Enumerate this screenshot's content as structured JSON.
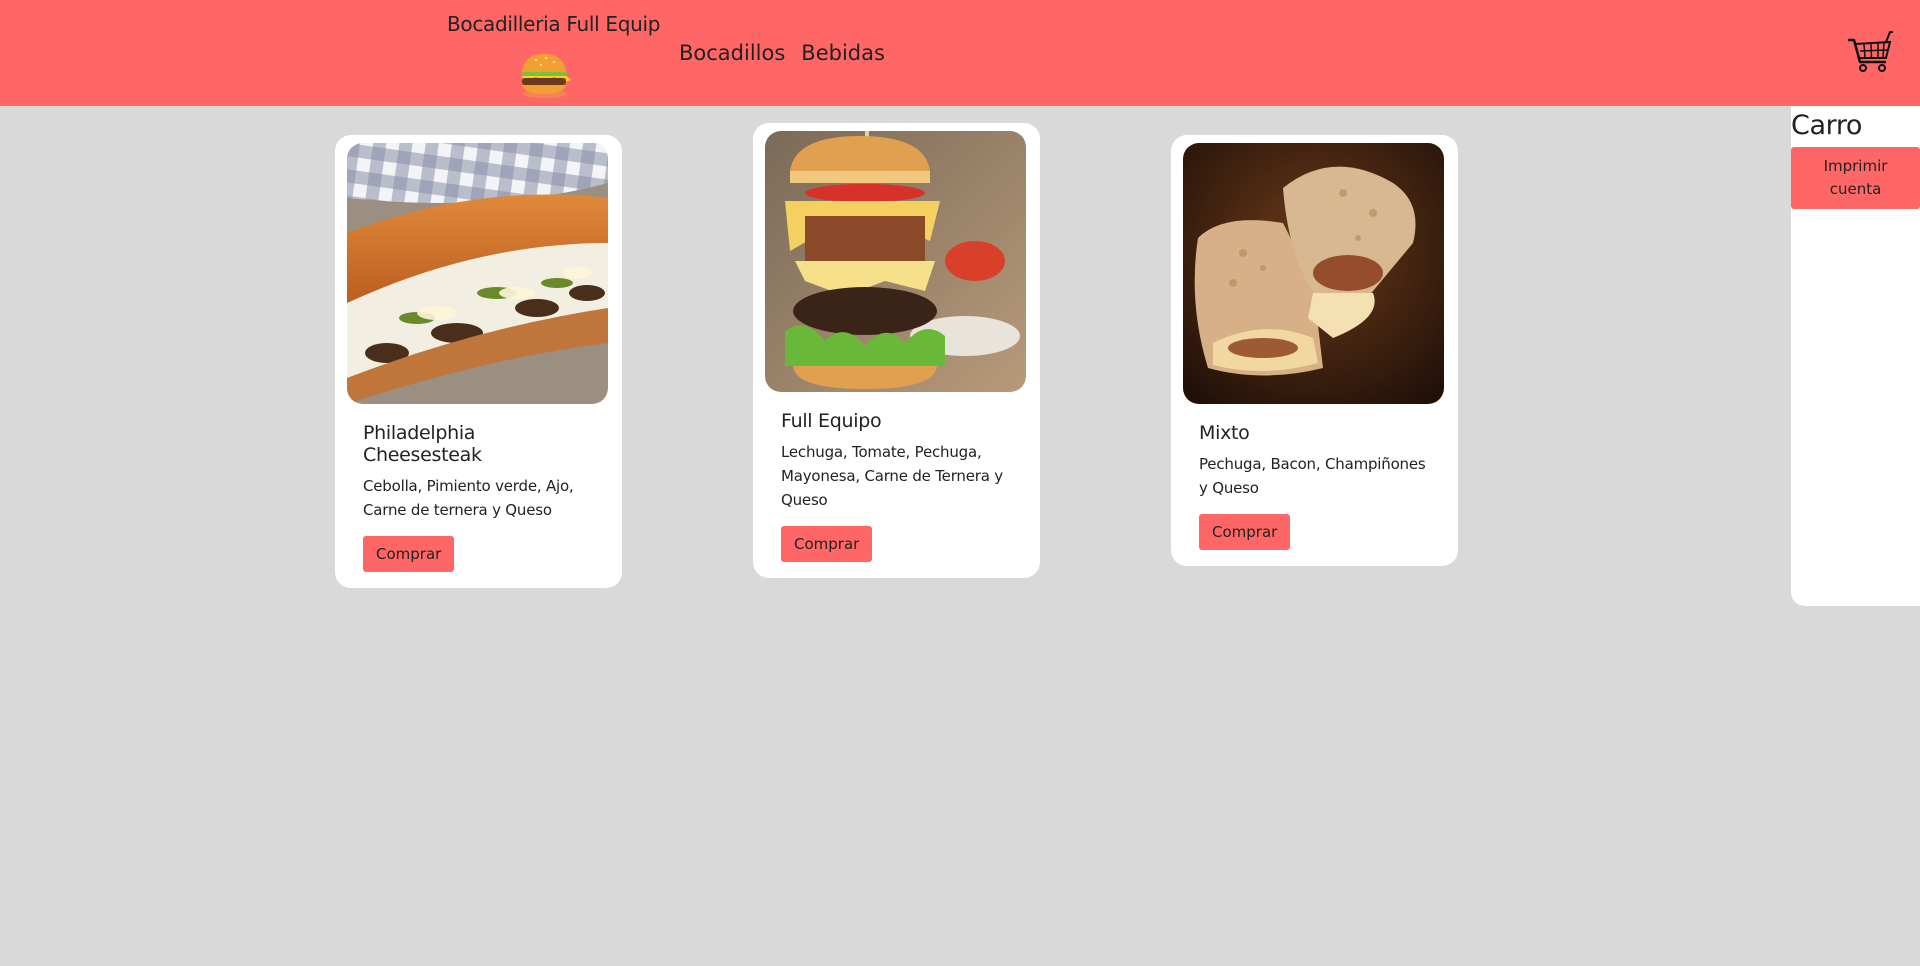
{
  "header": {
    "brand_name": "Bocadilleria Full Equip",
    "logo_icon": "hamburger-icon",
    "nav": [
      {
        "label": "Bocadillos"
      },
      {
        "label": "Bebidas"
      }
    ],
    "cart_icon": "shopping-cart-icon",
    "background_color": "#ff6666"
  },
  "products": [
    {
      "title": "Philadelphia Cheesesteak",
      "description": "Cebolla, Pimiento verde, Ajo, Carne de ternera y Queso",
      "button_label": "Comprar"
    },
    {
      "title": "Full Equipo",
      "description": "Lechuga, Tomate, Pechuga, Mayonesa, Carne de Ternera y Queso",
      "button_label": "Comprar"
    },
    {
      "title": "Mixto",
      "description": "Pechuga, Bacon, Champiñones y Queso",
      "button_label": "Comprar"
    }
  ],
  "cart": {
    "title": "Carro",
    "print_button_label": "Imprimir cuenta"
  },
  "colors": {
    "accent": "#ff6666",
    "page_background": "#d9d9d9",
    "card_background": "#ffffff"
  }
}
